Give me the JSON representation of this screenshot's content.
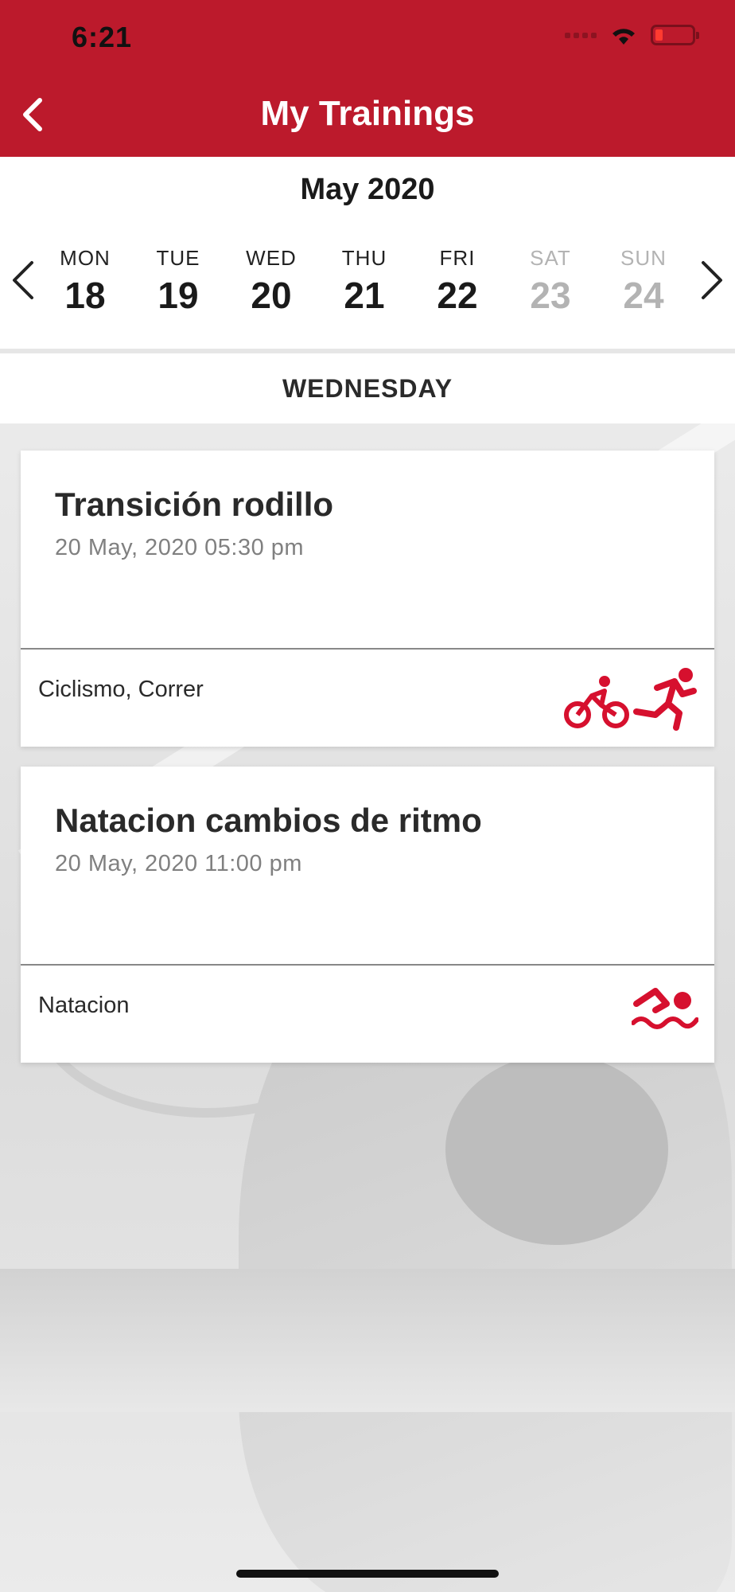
{
  "status": {
    "time": "6:21"
  },
  "header": {
    "title": "My Trainings"
  },
  "calendar": {
    "month": "May 2020",
    "days": [
      {
        "name": "MON",
        "num": "18"
      },
      {
        "name": "TUE",
        "num": "19"
      },
      {
        "name": "WED",
        "num": "20"
      },
      {
        "name": "THU",
        "num": "21"
      },
      {
        "name": "FRI",
        "num": "22"
      },
      {
        "name": "SAT",
        "num": "23"
      },
      {
        "name": "SUN",
        "num": "24"
      }
    ]
  },
  "selected_weekday": "WEDNESDAY",
  "trainings": [
    {
      "title": "Transición rodillo",
      "datetime": "20 May, 2020 05:30 pm",
      "sports": "Ciclismo, Correr",
      "icons": [
        "cycling-icon",
        "running-icon"
      ]
    },
    {
      "title": "Natacion cambios de ritmo",
      "datetime": "20 May, 2020 11:00 pm",
      "sports": "Natacion",
      "icons": [
        "swimming-icon"
      ]
    }
  ],
  "colors": {
    "brand": "#bc1a2c",
    "accent_icon": "#d6102e",
    "weekend_text": "#b3b3b3"
  }
}
